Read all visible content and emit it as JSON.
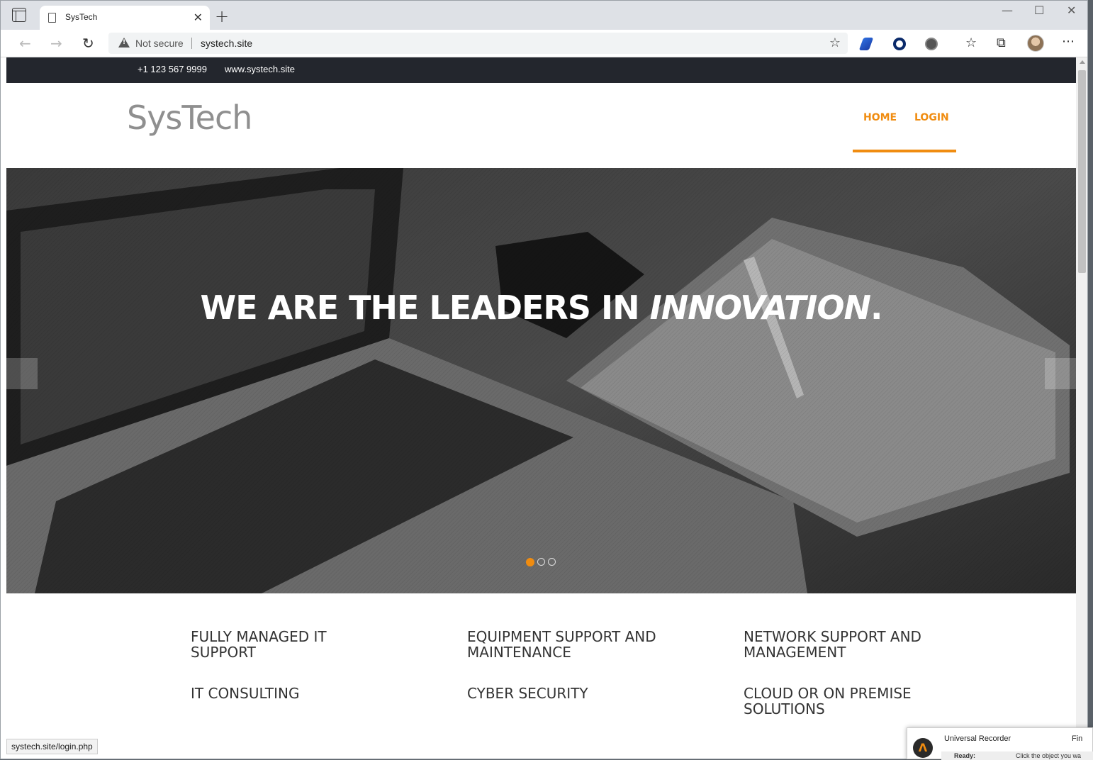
{
  "browser": {
    "tab_title": "SysTech",
    "security_label": "Not secure",
    "url": "systech.site",
    "status_url": "systech.site/login.php"
  },
  "site": {
    "phone": "+1 123 567 9999",
    "website": "www.systech.site",
    "logo": "SysTech",
    "menu": [
      "HOME",
      "LOGIN"
    ],
    "accent_color": "#f08c10"
  },
  "hero": {
    "title_prefix": "WE ARE THE LEADERS IN ",
    "title_emphasis": "INNOVATION",
    "title_suffix": ".",
    "slide_count": 3,
    "active_slide": 1
  },
  "services": [
    "FULLY MANAGED IT SUPPORT",
    "EQUIPMENT SUPPORT AND MAINTENANCE",
    "NETWORK SUPPORT AND MANAGEMENT",
    "IT CONSULTING",
    "CYBER SECURITY",
    "CLOUD OR ON PREMISE SOLUTIONS"
  ],
  "recorder": {
    "title": "Universal Recorder",
    "find_label": "Fin",
    "status": "Ready:",
    "hint": "Click the object you wa"
  }
}
